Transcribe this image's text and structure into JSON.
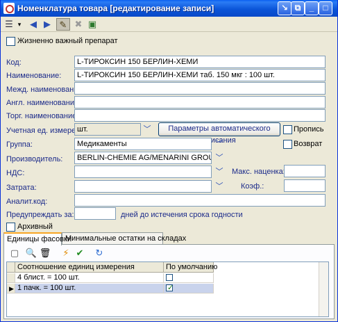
{
  "window": {
    "title": "Номенклатура товара [редактирование записи]",
    "controls": [
      "↘",
      "⧉",
      "_",
      "□",
      "X"
    ]
  },
  "toolbar": {
    "icons": [
      "menu-icon",
      "dropdown-arrow-icon",
      "back-arrow-icon",
      "forward-arrow-icon",
      "edit-brush-icon",
      "delete-icon",
      "save-close-icon"
    ],
    "glyphs": [
      "☰",
      "▾",
      "◀",
      "▶",
      "✎",
      "✖",
      "▣"
    ]
  },
  "form": {
    "vital_label": "Жизненно важный препарат",
    "vital_checked": false,
    "code_label": "Код:",
    "code_value": "L-ТИРОКСИН 150 БЕРЛИН-ХЕМИ",
    "name_label": "Наименование:",
    "name_value": "L-ТИРОКСИН 150 БЕРЛИН-ХЕМИ таб. 150 мкг : 100 шт.",
    "intl_name_label": "Межд. наименование:",
    "intl_name_value": "",
    "eng_name_label": "Англ. наименование:",
    "eng_name_value": "",
    "trade_name_label": "Торг. наименование:",
    "trade_name_value": "",
    "unit_label": "Учетная ед. измерения:",
    "unit_value": "шт.",
    "autowriteoff_button": "Параметры автоматического списания",
    "cursive_label": "Пропись",
    "cursive_checked": false,
    "group_label": "Группа:",
    "group_value": "Медикаменты",
    "return_label": "Возврат",
    "return_checked": false,
    "manufacturer_label": "Производитель:",
    "manufacturer_value": "BERLIN-CHEMIE AG/MENARINI GROUP",
    "vat_label": "НДС:",
    "vat_value": "",
    "max_markup_label": "Макс. наценка:",
    "max_markup_value": "",
    "cost_label": "Затрата:",
    "cost_value": "",
    "coef_label": "Коэф.:",
    "coef_value": "",
    "analytic_code_label": "Аналит.код:",
    "analytic_code_value": "",
    "warn_label": "Предупреждать за:",
    "warn_value": "",
    "warn_suffix": "дней до истечения срока годности",
    "archive_label": "Архивный",
    "archive_checked": false
  },
  "tabs": [
    {
      "label": "Единицы фасовки",
      "active": true
    },
    {
      "label": "Минимальные остатки на складах",
      "active": false
    }
  ],
  "grid_toolbar": {
    "icons": [
      "new-record-icon",
      "search-icon",
      "trash-icon",
      "lightning-icon",
      "checkmark-icon",
      "refresh-icon"
    ],
    "glyphs": [
      "▢",
      "🔍",
      "🗑",
      "⚡",
      "✔",
      "↻"
    ]
  },
  "grid": {
    "columns": [
      "Соотношение единиц измерения",
      "По умолчанию"
    ],
    "rows": [
      {
        "ratio": "4 блист. = 100 шт.",
        "default": false,
        "current": false
      },
      {
        "ratio": "1 пачк. = 100 шт.",
        "default": true,
        "current": true
      }
    ]
  }
}
